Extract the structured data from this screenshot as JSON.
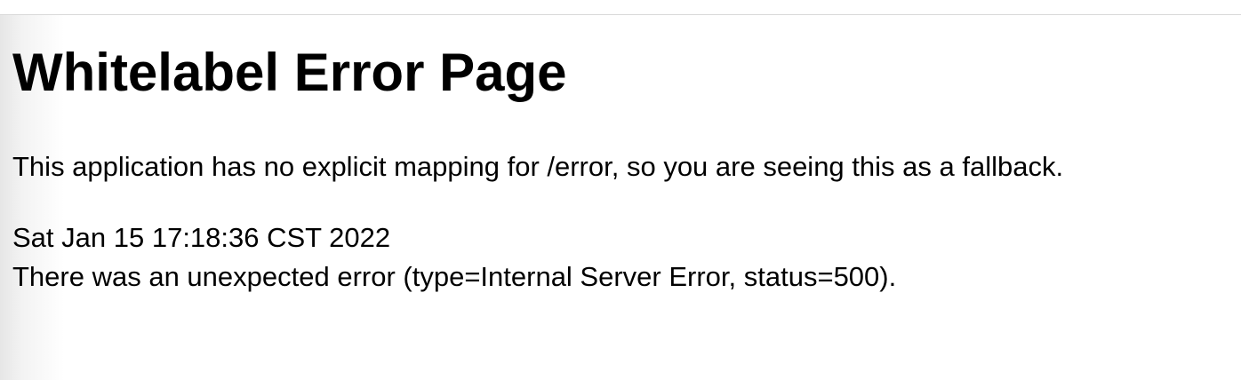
{
  "page": {
    "title": "Whitelabel Error Page",
    "message": "This application has no explicit mapping for /error, so you are seeing this as a fallback.",
    "timestamp": "Sat Jan 15 17:18:36 CST 2022",
    "error_detail": "There was an unexpected error (type=Internal Server Error, status=500)."
  }
}
